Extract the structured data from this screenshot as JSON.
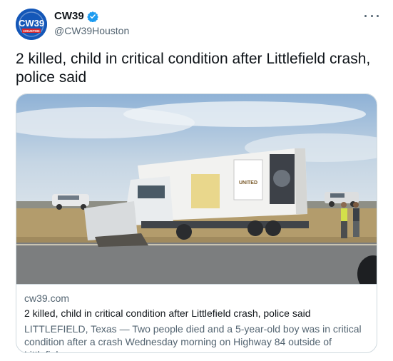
{
  "account": {
    "display_name": "CW39",
    "handle": "@CW39Houston",
    "avatar_logo_text": "CW39",
    "avatar_sub_text": "HOUSTON"
  },
  "tweet": {
    "text": "2 killed, child in critical condition after Littlefield crash, police said"
  },
  "card": {
    "domain": "cw39.com",
    "title": "2 killed, child in critical condition after Littlefield crash, police said",
    "description": "LITTLEFIELD, Texas — Two people died and a 5-year-old boy was in critical condition after a crash Wednesday morning on Highway 84 outside of Littlefiel...",
    "truck_brand_text": "UNITED"
  },
  "colors": {
    "verified_blue": "#1d9bf0",
    "avatar_blue": "#1457b8",
    "text_primary": "#0f1419",
    "text_secondary": "#536471",
    "border": "#cfd9de"
  }
}
